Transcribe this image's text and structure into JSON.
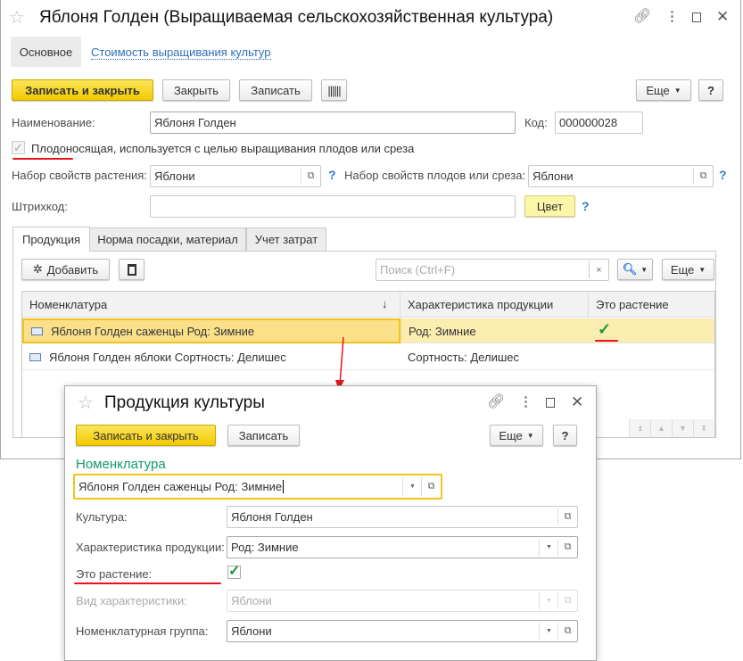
{
  "main": {
    "title": "Яблоня Голден (Выращиваемая сельскохозяйственная культура)",
    "nav": {
      "main": "Основное",
      "link": "Стоимость выращивания культур"
    },
    "toolbar": {
      "save_close": "Записать и закрыть",
      "close": "Закрыть",
      "save": "Записать",
      "more": "Еще",
      "help": "?"
    },
    "fields": {
      "name_label": "Наименование:",
      "name_value": "Яблоня Голден",
      "code_label": "Код:",
      "code_value": "000000028",
      "fruit_bearing_label": "Плодоносящая",
      "fruit_bearing_rest": ", используется с целью выращивания плодов или среза",
      "fruit_bearing_checked": true,
      "plant_props_label": "Набор свойств растения:",
      "plant_props_value": "Яблони",
      "fruit_props_label": "Набор свойств плодов или среза:",
      "fruit_props_value": "Яблони",
      "barcode_label": "Штрихкод:",
      "barcode_value": "",
      "color_button": "Цвет",
      "help": "?"
    },
    "tabs": [
      "Продукция",
      "Норма посадки, материал",
      "Учет затрат"
    ],
    "table_toolbar": {
      "add": "Добавить",
      "search_placeholder": "Поиск (Ctrl+F)",
      "clear": "×",
      "more": "Еще"
    },
    "table": {
      "columns": [
        "Номенклатура",
        "Характеристика продукции",
        "Это растение"
      ],
      "sort_indicator": "↓",
      "rows": [
        {
          "nomenclature": "Яблоня Голден саженцы Род: Зимние",
          "characteristic": "Род: Зимние",
          "is_plant": "✓"
        },
        {
          "nomenclature": "Яблоня Голден яблоки Сортность: Делишес",
          "characteristic": "Сортность: Делишес",
          "is_plant": ""
        }
      ]
    }
  },
  "dialog": {
    "title": "Продукция культуры",
    "toolbar": {
      "save_close": "Записать и закрыть",
      "save": "Записать",
      "more": "Еще",
      "help": "?"
    },
    "nomenclature_label": "Номенклатура",
    "nomenclature_value": "Яблоня Голден саженцы Род: Зимние",
    "fields": [
      {
        "label": "Культура:",
        "value": "Яблоня Голден"
      },
      {
        "label": "Характеристика продукции:",
        "value": "Род: Зимние"
      },
      {
        "label": "Это растение:",
        "checked": true
      },
      {
        "label": "Вид характеристики:",
        "value": "Яблони",
        "disabled": true
      },
      {
        "label": "Номенклатурная группа:",
        "value": "Яблони"
      }
    ]
  },
  "colors": {
    "accent_yellow": "#f2ca00",
    "highlight": "#fbe9a6",
    "green": "#1a9b3a",
    "red": "#e8141b",
    "link": "#2d6fb7"
  }
}
